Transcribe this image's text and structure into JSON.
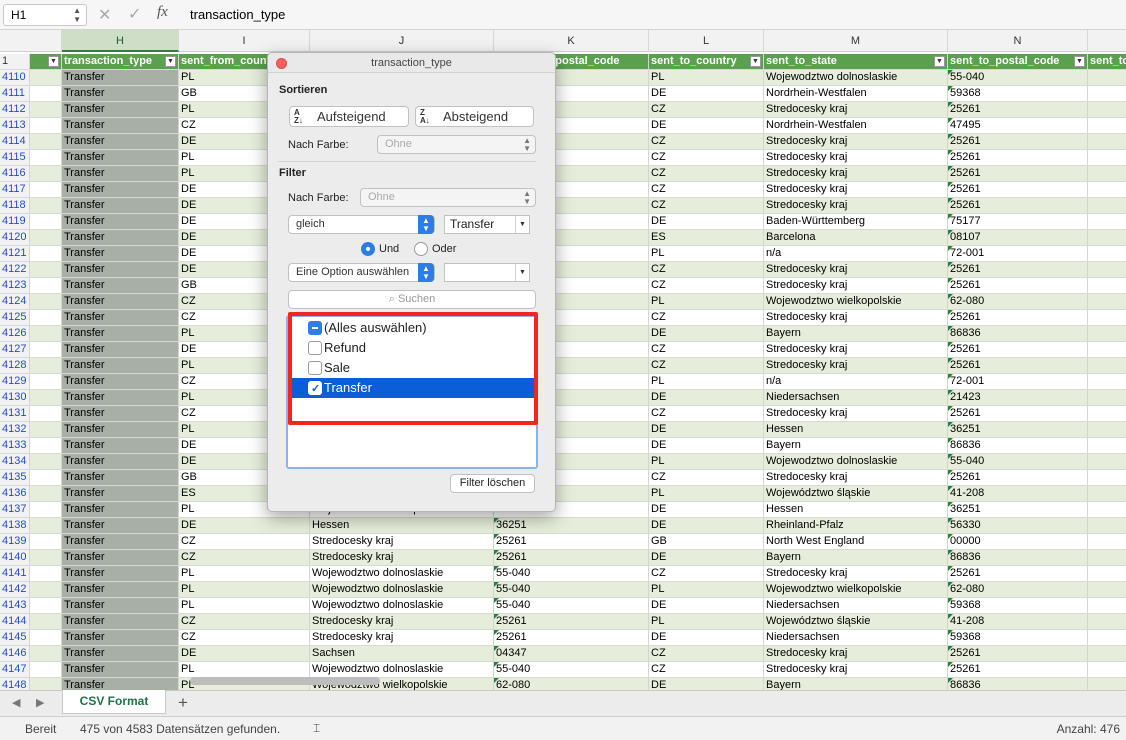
{
  "formula_bar": {
    "name_box": "H1",
    "formula": "transaction_type"
  },
  "columns": [
    {
      "letter": "H",
      "selected": true
    },
    {
      "letter": "I"
    },
    {
      "letter": "J"
    },
    {
      "letter": "K"
    },
    {
      "letter": "L"
    },
    {
      "letter": "M"
    },
    {
      "letter": "N"
    }
  ],
  "header_row": {
    "row_number": "1",
    "cells": [
      "transaction_type",
      "sent_from_country",
      "",
      "sent_from_postal_code",
      "sent_to_country",
      "sent_to_state",
      "sent_to_postal_code",
      "sent_to"
    ]
  },
  "rows": [
    {
      "n": "4110",
      "h": "Transfer",
      "i": "PL",
      "j": "",
      "k": "",
      "l": "PL",
      "m": "Wojewodztwo dolnoslaskie",
      "nn": "55-040"
    },
    {
      "n": "4111",
      "h": "Transfer",
      "i": "GB",
      "j": "",
      "k": "",
      "l": "DE",
      "m": "Nordrhein-Westfalen",
      "nn": "59368"
    },
    {
      "n": "4112",
      "h": "Transfer",
      "i": "PL",
      "j": "",
      "k": "",
      "l": "CZ",
      "m": "Stredocesky kraj",
      "nn": "25261"
    },
    {
      "n": "4113",
      "h": "Transfer",
      "i": "CZ",
      "j": "",
      "k": "",
      "l": "DE",
      "m": "Nordrhein-Westfalen",
      "nn": "47495"
    },
    {
      "n": "4114",
      "h": "Transfer",
      "i": "DE",
      "j": "",
      "k": "",
      "l": "CZ",
      "m": "Stredocesky kraj",
      "nn": "25261"
    },
    {
      "n": "4115",
      "h": "Transfer",
      "i": "PL",
      "j": "",
      "k": "",
      "l": "CZ",
      "m": "Stredocesky kraj",
      "nn": "25261"
    },
    {
      "n": "4116",
      "h": "Transfer",
      "i": "PL",
      "j": "",
      "k": "",
      "l": "CZ",
      "m": "Stredocesky kraj",
      "nn": "25261"
    },
    {
      "n": "4117",
      "h": "Transfer",
      "i": "DE",
      "j": "",
      "k": "",
      "l": "CZ",
      "m": "Stredocesky kraj",
      "nn": "25261"
    },
    {
      "n": "4118",
      "h": "Transfer",
      "i": "DE",
      "j": "",
      "k": "",
      "l": "CZ",
      "m": "Stredocesky kraj",
      "nn": "25261"
    },
    {
      "n": "4119",
      "h": "Transfer",
      "i": "DE",
      "j": "",
      "k": "",
      "l": "DE",
      "m": "Baden-Württemberg",
      "nn": "75177"
    },
    {
      "n": "4120",
      "h": "Transfer",
      "i": "DE",
      "j": "",
      "k": "",
      "l": "ES",
      "m": "Barcelona",
      "nn": "08107"
    },
    {
      "n": "4121",
      "h": "Transfer",
      "i": "DE",
      "j": "",
      "k": "",
      "l": "PL",
      "m": "n/a",
      "nn": "72-001"
    },
    {
      "n": "4122",
      "h": "Transfer",
      "i": "DE",
      "j": "",
      "k": "",
      "l": "CZ",
      "m": "Stredocesky kraj",
      "nn": "25261"
    },
    {
      "n": "4123",
      "h": "Transfer",
      "i": "GB",
      "j": "",
      "k": "",
      "l": "CZ",
      "m": "Stredocesky kraj",
      "nn": "25261"
    },
    {
      "n": "4124",
      "h": "Transfer",
      "i": "CZ",
      "j": "",
      "k": "",
      "l": "PL",
      "m": "Wojewodztwo wielkopolskie",
      "nn": "62-080"
    },
    {
      "n": "4125",
      "h": "Transfer",
      "i": "CZ",
      "j": "",
      "k": "",
      "l": "CZ",
      "m": "Stredocesky kraj",
      "nn": "25261"
    },
    {
      "n": "4126",
      "h": "Transfer",
      "i": "PL",
      "j": "",
      "k": "",
      "l": "DE",
      "m": "Bayern",
      "nn": "86836"
    },
    {
      "n": "4127",
      "h": "Transfer",
      "i": "DE",
      "j": "",
      "k": "",
      "l": "CZ",
      "m": "Stredocesky kraj",
      "nn": "25261"
    },
    {
      "n": "4128",
      "h": "Transfer",
      "i": "PL",
      "j": "",
      "k": "",
      "l": "CZ",
      "m": "Stredocesky kraj",
      "nn": "25261"
    },
    {
      "n": "4129",
      "h": "Transfer",
      "i": "CZ",
      "j": "",
      "k": "",
      "l": "PL",
      "m": "n/a",
      "nn": "72-001"
    },
    {
      "n": "4130",
      "h": "Transfer",
      "i": "PL",
      "j": "",
      "k": "",
      "l": "DE",
      "m": "Niedersachsen",
      "nn": "21423"
    },
    {
      "n": "4131",
      "h": "Transfer",
      "i": "CZ",
      "j": "",
      "k": "",
      "l": "CZ",
      "m": "Stredocesky kraj",
      "nn": "25261"
    },
    {
      "n": "4132",
      "h": "Transfer",
      "i": "PL",
      "j": "",
      "k": "",
      "l": "DE",
      "m": "Hessen",
      "nn": "36251"
    },
    {
      "n": "4133",
      "h": "Transfer",
      "i": "DE",
      "j": "",
      "k": "",
      "l": "DE",
      "m": "Bayern",
      "nn": "86836"
    },
    {
      "n": "4134",
      "h": "Transfer",
      "i": "DE",
      "j": "",
      "k": "",
      "l": "PL",
      "m": "Wojewodztwo dolnoslaskie",
      "nn": "55-040"
    },
    {
      "n": "4135",
      "h": "Transfer",
      "i": "GB",
      "j": "",
      "k": "",
      "l": "CZ",
      "m": "Stredocesky kraj",
      "nn": "25261"
    },
    {
      "n": "4136",
      "h": "Transfer",
      "i": "ES",
      "j": "",
      "k": "",
      "l": "PL",
      "m": "Województwo śląskie",
      "nn": "41-208"
    },
    {
      "n": "4137",
      "h": "Transfer",
      "i": "PL",
      "j": "Wojewodztwo wielkopolskie",
      "k": "",
      "l": "DE",
      "m": "Hessen",
      "nn": "36251"
    },
    {
      "n": "4138",
      "h": "Transfer",
      "i": "DE",
      "j": "Hessen",
      "k": "36251",
      "l": "DE",
      "m": "Rheinland-Pfalz",
      "nn": "56330"
    },
    {
      "n": "4139",
      "h": "Transfer",
      "i": "CZ",
      "j": "Stredocesky kraj",
      "k": "25261",
      "l": "GB",
      "m": "North West England",
      "nn": "00000"
    },
    {
      "n": "4140",
      "h": "Transfer",
      "i": "CZ",
      "j": "Stredocesky kraj",
      "k": "25261",
      "l": "DE",
      "m": "Bayern",
      "nn": "86836"
    },
    {
      "n": "4141",
      "h": "Transfer",
      "i": "PL",
      "j": "Wojewodztwo dolnoslaskie",
      "k": "55-040",
      "l": "CZ",
      "m": "Stredocesky kraj",
      "nn": "25261"
    },
    {
      "n": "4142",
      "h": "Transfer",
      "i": "PL",
      "j": "Wojewodztwo dolnoslaskie",
      "k": "55-040",
      "l": "PL",
      "m": "Wojewodztwo wielkopolskie",
      "nn": "62-080"
    },
    {
      "n": "4143",
      "h": "Transfer",
      "i": "PL",
      "j": "Wojewodztwo dolnoslaskie",
      "k": "55-040",
      "l": "DE",
      "m": "Niedersachsen",
      "nn": "59368"
    },
    {
      "n": "4144",
      "h": "Transfer",
      "i": "CZ",
      "j": "Stredocesky kraj",
      "k": "25261",
      "l": "PL",
      "m": "Województwo śląskie",
      "nn": "41-208"
    },
    {
      "n": "4145",
      "h": "Transfer",
      "i": "CZ",
      "j": "Stredocesky kraj",
      "k": "25261",
      "l": "DE",
      "m": "Niedersachsen",
      "nn": "59368"
    },
    {
      "n": "4146",
      "h": "Transfer",
      "i": "DE",
      "j": "Sachsen",
      "k": "04347",
      "l": "CZ",
      "m": "Stredocesky kraj",
      "nn": "25261"
    },
    {
      "n": "4147",
      "h": "Transfer",
      "i": "PL",
      "j": "Wojewodztwo dolnoslaskie",
      "k": "55-040",
      "l": "CZ",
      "m": "Stredocesky kraj",
      "nn": "25261"
    },
    {
      "n": "4148",
      "h": "Transfer",
      "i": "PL",
      "j": "Wojewodztwo wielkopolskie",
      "k": "62-080",
      "l": "DE",
      "m": "Bayern",
      "nn": "86836"
    }
  ],
  "filter_popup": {
    "title": "transaction_type",
    "sort_heading": "Sortieren",
    "sort_asc": "Aufsteigend",
    "sort_desc": "Absteigend",
    "sort_color_label": "Nach Farbe:",
    "sort_color_value": "Ohne",
    "filter_heading": "Filter",
    "filter_color_label": "Nach Farbe:",
    "filter_color_value": "Ohne",
    "condition1_op": "gleich",
    "condition1_value": "Transfer",
    "and_label": "Und",
    "or_label": "Oder",
    "condition2_op": "Eine Option auswählen",
    "condition2_value": "",
    "search_placeholder": "Suchen",
    "items": [
      {
        "label": "(Alles auswählen)",
        "state": "indeterminate"
      },
      {
        "label": "Refund",
        "state": "unchecked"
      },
      {
        "label": "Sale",
        "state": "unchecked"
      },
      {
        "label": "Transfer",
        "state": "checked"
      }
    ],
    "clear_button": "Filter löschen"
  },
  "sheet_tab": "CSV Format",
  "status": {
    "ready": "Bereit",
    "found": "475 von 4583 Datensätzen gefunden.",
    "count": "Anzahl: 476"
  },
  "colors": {
    "header_green": "#5aa04e",
    "band_green": "#e6eedb",
    "highlight_red": "#f0271a",
    "selection_blue": "#0b5ed7"
  }
}
